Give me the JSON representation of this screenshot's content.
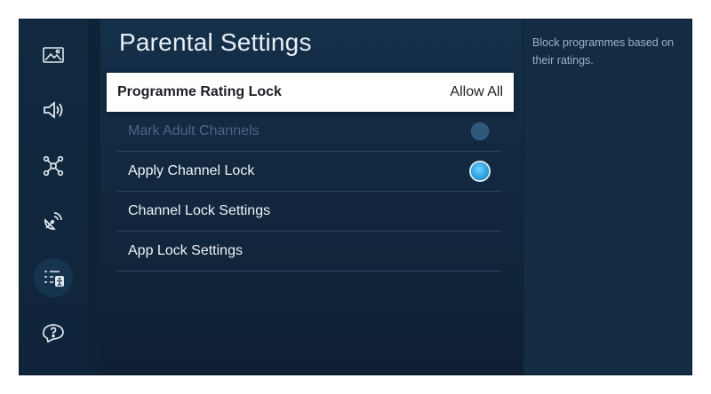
{
  "page": {
    "title": "Parental Settings"
  },
  "sidebar": {
    "items": [
      {
        "icon": "picture-icon",
        "active": false
      },
      {
        "icon": "sound-icon",
        "active": false
      },
      {
        "icon": "connection-icon",
        "active": false
      },
      {
        "icon": "broadcasting-icon",
        "active": false
      },
      {
        "icon": "general-accessibility-icon",
        "active": true
      },
      {
        "icon": "support-icon",
        "active": false
      }
    ]
  },
  "menu": {
    "items": [
      {
        "label": "Programme Rating Lock",
        "value": "Allow All",
        "focused": true
      },
      {
        "label": "Mark Adult Channels",
        "toggle": "off",
        "disabled": true
      },
      {
        "label": "Apply Channel Lock",
        "toggle": "on"
      },
      {
        "label": "Channel Lock Settings"
      },
      {
        "label": "App Lock Settings"
      }
    ]
  },
  "help": {
    "text": "Block programmes based on their ratings."
  },
  "colors": {
    "accent": "#2ea3e4",
    "background": "#12283f",
    "focus": "#ffffff"
  }
}
